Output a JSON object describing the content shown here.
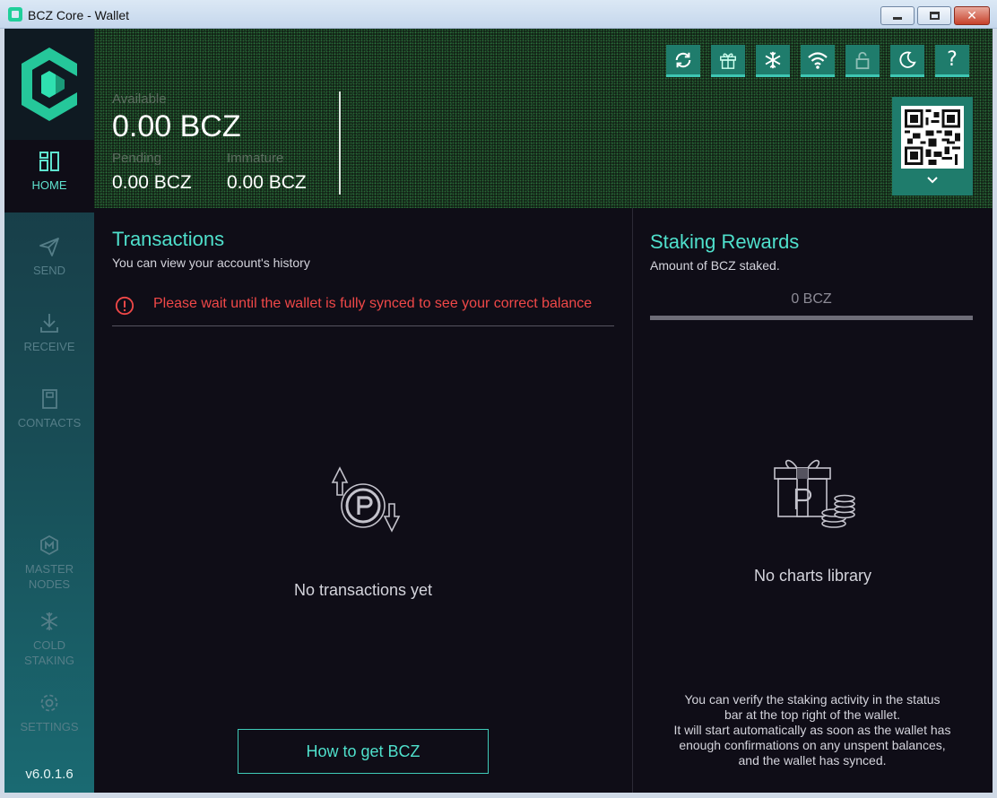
{
  "window": {
    "title": "BCZ Core - Wallet",
    "min_glyph": "",
    "close_glyph": "✕"
  },
  "sidebar": {
    "items": [
      {
        "label": "HOME",
        "icon": "home-icon",
        "active": true
      },
      {
        "label": "SEND",
        "icon": "send-icon",
        "active": false
      },
      {
        "label": "RECEIVE",
        "icon": "receive-icon",
        "active": false
      },
      {
        "label": "CONTACTS",
        "icon": "contacts-icon",
        "active": false
      },
      {
        "label": "MASTER NODES",
        "icon": "masternodes-icon",
        "active": false
      },
      {
        "label": "COLD STAKING",
        "icon": "cold-staking-icon",
        "active": false
      },
      {
        "label": "SETTINGS",
        "icon": "settings-icon",
        "active": false
      }
    ],
    "version": "v6.0.1.6"
  },
  "header": {
    "available_label": "Available",
    "available_value": "0.00 BCZ",
    "pending_label": "Pending",
    "pending_value": "0.00 BCZ",
    "immature_label": "Immature",
    "immature_value": "0.00 BCZ",
    "buttons": [
      "sync-icon",
      "gift-icon",
      "snowflake-icon",
      "wifi-icon",
      "lock-icon",
      "moon-icon",
      "help-icon"
    ],
    "help_glyph": "?"
  },
  "transactions": {
    "title": "Transactions",
    "subtitle": "You can view your account's history",
    "sync_warning": "Please wait until the wallet is fully synced to see your correct balance",
    "empty_text": "No transactions yet",
    "howto_button": "How to get BCZ"
  },
  "staking": {
    "title": "Staking Rewards",
    "subtitle": "Amount of BCZ staked.",
    "value": "0 BCZ",
    "empty_text": "No charts library",
    "note_lines": [
      "You can verify the staking activity in the status",
      "bar at the top right of the wallet.",
      "It will start automatically as soon as the wallet has",
      "enough confirmations on any unspent balances,",
      "and the wallet has synced."
    ]
  },
  "colors": {
    "accent": "#4fe0cc",
    "warning": "#f04848",
    "background": "#0f0d17",
    "button": "#1f7c6c"
  }
}
